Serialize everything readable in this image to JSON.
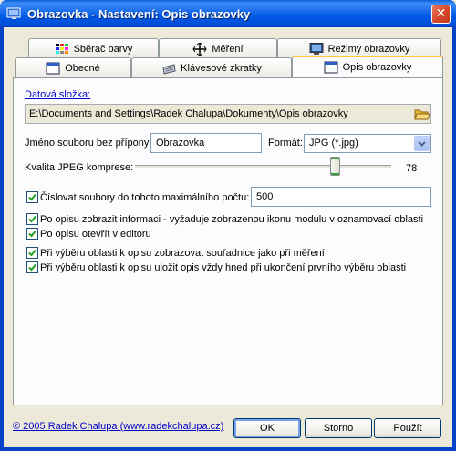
{
  "window": {
    "title": "Obrazovka - Nastavení: Opis obrazovky",
    "close_glyph": "✕"
  },
  "tabs": {
    "row_back": [
      {
        "label": "Sběrač barvy",
        "icon": "color-grid-icon"
      },
      {
        "label": "Měření",
        "icon": "measure-cross-icon"
      },
      {
        "label": "Režimy obrazovky",
        "icon": "monitor-icon"
      }
    ],
    "row_front": [
      {
        "label": "Obecné",
        "icon": "window-icon"
      },
      {
        "label": "Klávesové zkratky",
        "icon": "keyboard-icon"
      },
      {
        "label": "Opis obrazovky",
        "icon": "screen-capture-icon",
        "active": true
      }
    ]
  },
  "form": {
    "data_folder_label": "Datová složka:",
    "data_folder_path": "E:\\Documents and Settings\\Radek Chalupa\\Dokumenty\\Opis obrazovky",
    "filename_label": "Jméno souboru bez přípony:",
    "filename_value": "Obrazovka",
    "format_label": "Formát:",
    "format_value": "JPG (*.jpg)",
    "jpeg_label": "Kvalita JPEG komprese:",
    "jpeg_value": "78",
    "jpeg_quality_fraction": 0.78,
    "number_files_label": "Číslovat soubory do tohoto maximálního počtu:",
    "number_files_value": "500",
    "checkboxes": [
      {
        "label": "Číslovat soubory do tohoto maximálního počtu:",
        "checked": true
      },
      {
        "label": "Po opisu zobrazit informaci - vyžaduje zobrazenou ikonu modulu v oznamovací oblasti",
        "checked": true
      },
      {
        "label": "Po opisu otevřít v editoru",
        "checked": true
      },
      {
        "label": "Při výběru oblasti k opisu zobrazovat souřadnice jako při měření",
        "checked": true
      },
      {
        "label": "Při výběru oblasti k opisu uložit opis vždy hned při ukončení prvního výběru oblasti",
        "checked": true
      }
    ]
  },
  "footer": {
    "copyright": "© 2005 Radek Chalupa (www.radekchalupa.cz)",
    "ok": "OK",
    "cancel": "Storno",
    "apply": "Použít"
  },
  "colors": {
    "title_blue": "#0058E6",
    "close_red": "#D5472A",
    "face": "#ECE9D8",
    "check_green": "#21A121",
    "link_blue": "#0000CC"
  }
}
